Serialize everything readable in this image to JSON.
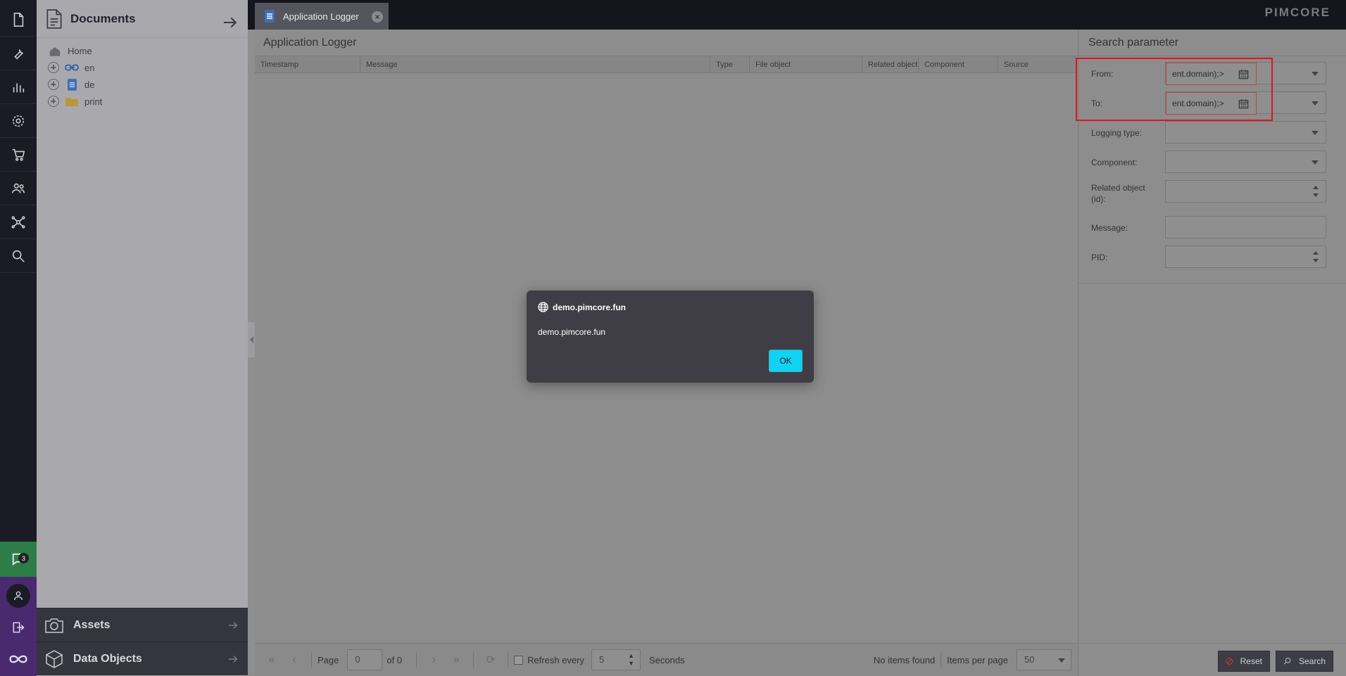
{
  "rail": {
    "icons": [
      "document-icon",
      "wrench-icon",
      "bar-chart-icon",
      "gear-icon",
      "cart-icon",
      "users-icon",
      "network-icon",
      "search-icon"
    ],
    "notification_count": "3"
  },
  "tree": {
    "title": "Documents",
    "items": [
      {
        "label": "Home",
        "icon": "home-icon"
      },
      {
        "label": "en",
        "icon": "link-icon"
      },
      {
        "label": "de",
        "icon": "page-icon"
      },
      {
        "label": "print",
        "icon": "folder-icon"
      }
    ],
    "accordion": [
      {
        "label": "Assets",
        "icon": "camera-icon"
      },
      {
        "label": "Data Objects",
        "icon": "cube-icon"
      }
    ]
  },
  "tab": {
    "label": "Application Logger"
  },
  "logo": "PIMCORE",
  "main": {
    "title": "Application Logger",
    "columns": [
      "Timestamp",
      "Message",
      "Type",
      "File object",
      "Related object",
      "Component",
      "Source"
    ]
  },
  "pager": {
    "page_label": "Page",
    "page_value": "0",
    "of_label": "of 0",
    "refresh_label": "Refresh every",
    "refresh_value": "5",
    "seconds_label": "Seconds",
    "status": "No items found",
    "items_per_page_label": "Items per page",
    "items_per_page_value": "50"
  },
  "search": {
    "title": "Search parameter",
    "fields": {
      "from": {
        "label": "From:",
        "value": "ent.domain);>"
      },
      "to": {
        "label": "To:",
        "value": "ent.domain);>"
      },
      "logging_type": {
        "label": "Logging type:"
      },
      "component": {
        "label": "Component:"
      },
      "related_object": {
        "label": "Related object (id):"
      },
      "message": {
        "label": "Message:"
      },
      "pid": {
        "label": "PID:"
      }
    },
    "reset_label": "Reset",
    "search_label": "Search"
  },
  "dialog": {
    "origin": "demo.pimcore.fun",
    "message": "demo.pimcore.fun",
    "ok_label": "OK"
  },
  "colors": {
    "accent_cyan": "#0fd3f2",
    "highlight_red": "#e0141e",
    "rail_bg": "#1b1b25",
    "notify_green": "#2e7d49",
    "profile_purple": "#4a2a6e"
  }
}
